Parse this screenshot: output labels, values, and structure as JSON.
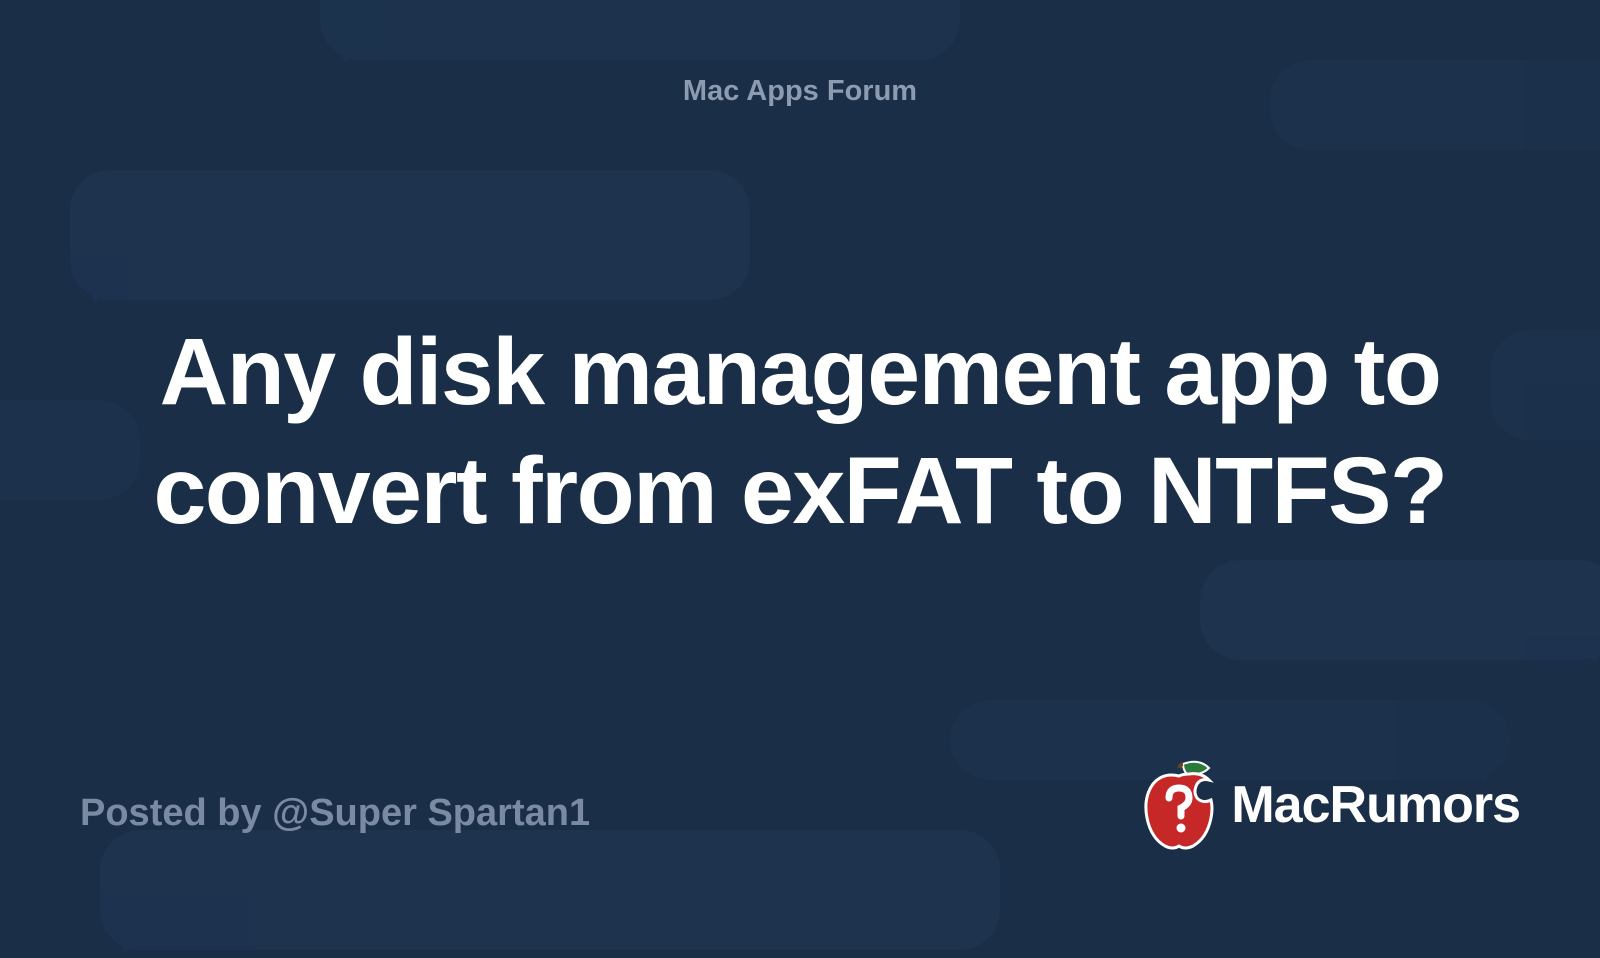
{
  "forum": {
    "label": "Mac Apps Forum"
  },
  "post": {
    "title": "Any disk management app to convert from exFAT to NTFS?",
    "author_prefix": "Posted by ",
    "author": "@Super Spartan1"
  },
  "brand": {
    "name": "MacRumors"
  }
}
